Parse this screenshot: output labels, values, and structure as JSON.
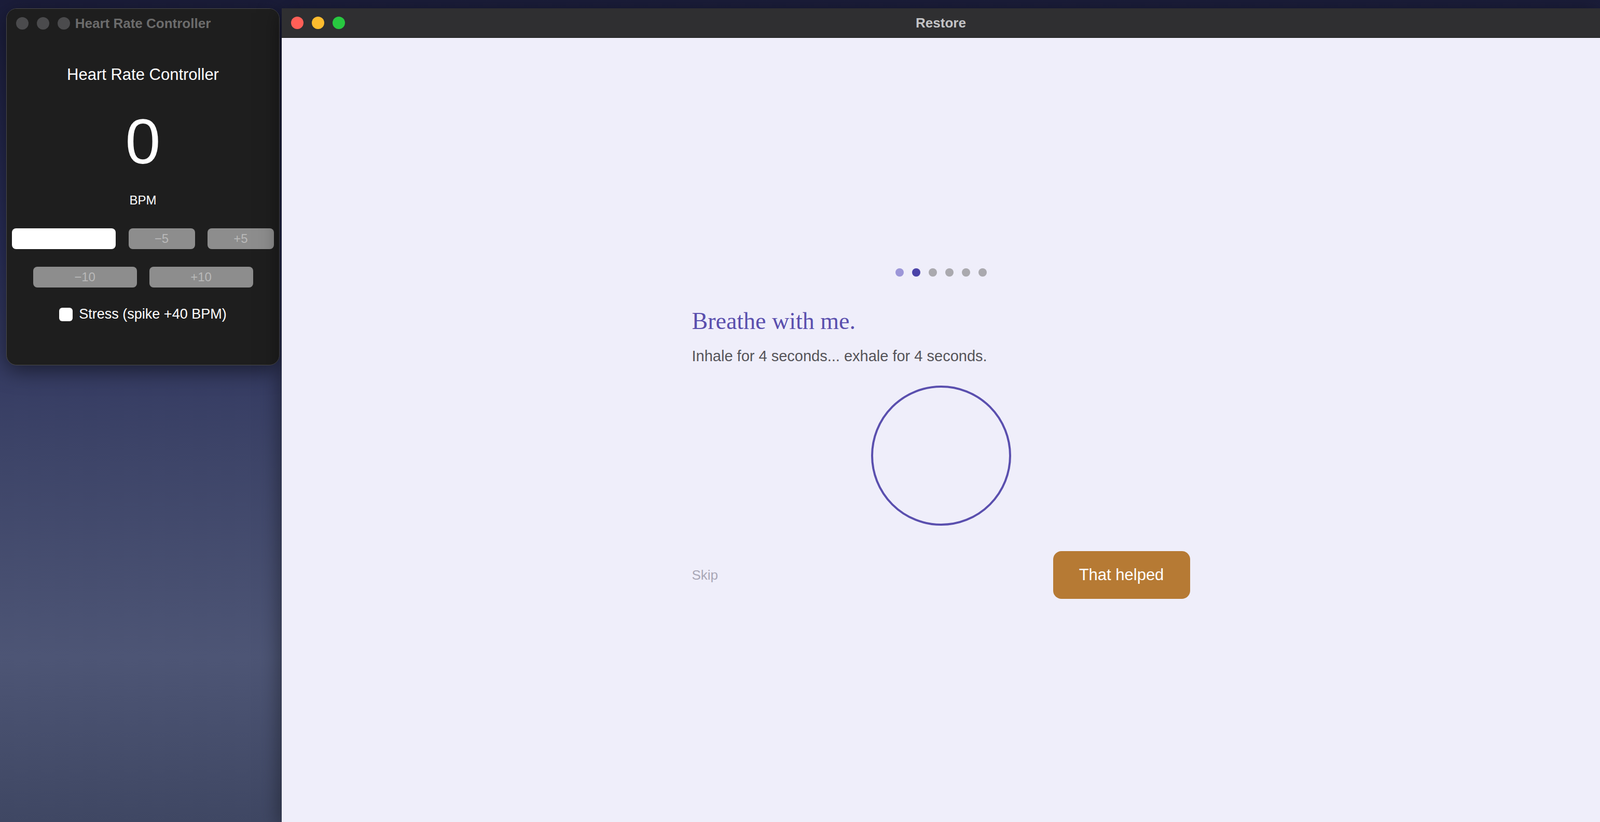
{
  "controller": {
    "title": "Heart Rate Controller",
    "active": false,
    "heading": "Heart Rate Controller",
    "bpm": "0",
    "unit": "BPM",
    "input_value": "",
    "button_rows": [
      [
        {
          "label": "−5",
          "disabled": true
        },
        {
          "label": "+5",
          "disabled": true
        }
      ],
      [
        {
          "label": "−10",
          "disabled": true
        },
        {
          "label": "+10",
          "disabled": true
        }
      ]
    ],
    "stress": {
      "label": "Stress (spike +40 BPM)",
      "checked": false
    }
  },
  "restore": {
    "title": "Restore",
    "active": true,
    "steps": [
      {
        "done": true,
        "selected": false
      },
      {
        "done": false,
        "selected": true
      },
      {
        "done": false,
        "selected": false
      },
      {
        "done": false,
        "selected": false
      },
      {
        "done": false,
        "selected": false
      },
      {
        "done": false,
        "selected": false
      }
    ],
    "heading": "Breathe with me.",
    "body": "Inhale for 4 seconds... exhale for 4 seconds.",
    "skip": "Skip",
    "primary": "That helped"
  }
}
